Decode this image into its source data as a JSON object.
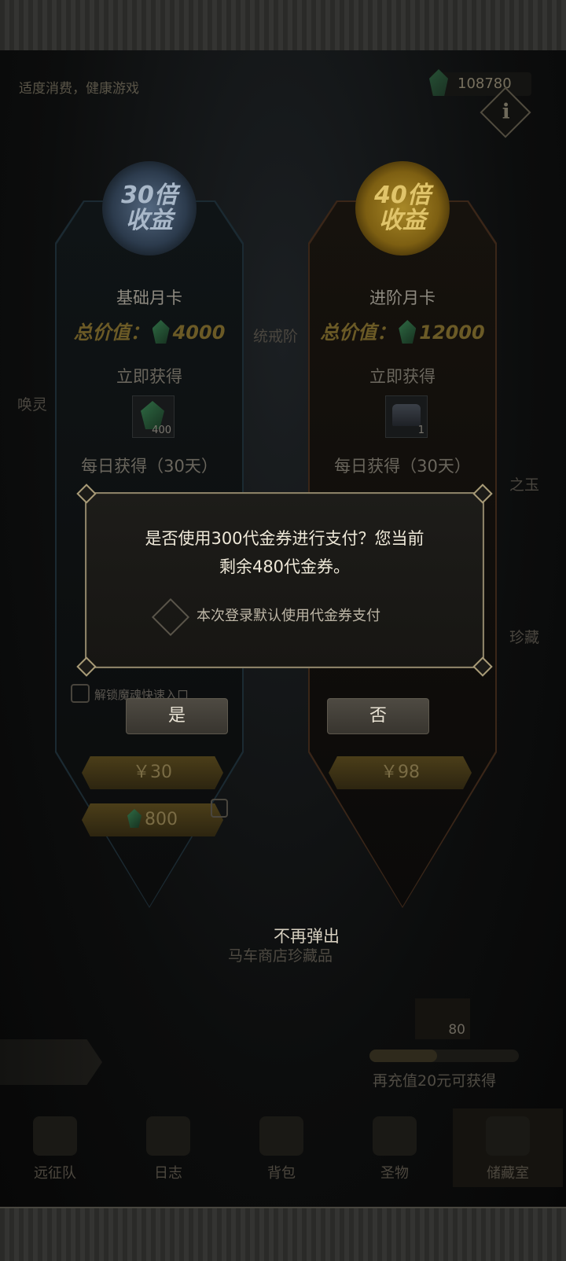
{
  "header": {
    "health_notice": "适度消费，健康游戏",
    "currency_amount": "108780",
    "info_label": "i"
  },
  "cards": [
    {
      "badge_multiplier": "30倍",
      "badge_sub": "收益",
      "title": "基础月卡",
      "total_label": "总价值：",
      "total_value": "4000",
      "instant_label": "立即获得",
      "instant_item_count": "400",
      "daily_label": "每日获得（30天）",
      "perk_unlock": "解锁魔魂快速入口",
      "price": "￥30",
      "gem_price": "800"
    },
    {
      "badge_multiplier": "40倍",
      "badge_sub": "收益",
      "title": "进阶月卡",
      "total_label": "总价值：",
      "total_value": "12000",
      "instant_label": "立即获得",
      "instant_item_count": "1",
      "daily_label": "每日获得（30天）",
      "price": "￥98"
    }
  ],
  "side_labels": {
    "left": "唤灵",
    "right_1": "之玉",
    "right_2": "珍藏",
    "center_faded": "统戒阶"
  },
  "modal": {
    "line1": "是否使用300代金券进行支付？您当前",
    "line2": "剩余480代金券。",
    "checkbox_label": "本次登录默认使用代金券支付",
    "yes_label": "是",
    "no_label": "否"
  },
  "no_popup_label": "不再弹出",
  "shop_label": "马车商店珍藏品",
  "reward": {
    "count": "80",
    "progress_fraction": 0.45,
    "recharge_text": "再充值20元可获得"
  },
  "nav": [
    {
      "label": "远征队",
      "icon": "horned-helmet-icon"
    },
    {
      "label": "日志",
      "icon": "scroll-icon"
    },
    {
      "label": "背包",
      "icon": "bag-icon"
    },
    {
      "label": "圣物",
      "icon": "relic-icon"
    },
    {
      "label": "储藏室",
      "icon": "storage-icon"
    }
  ]
}
